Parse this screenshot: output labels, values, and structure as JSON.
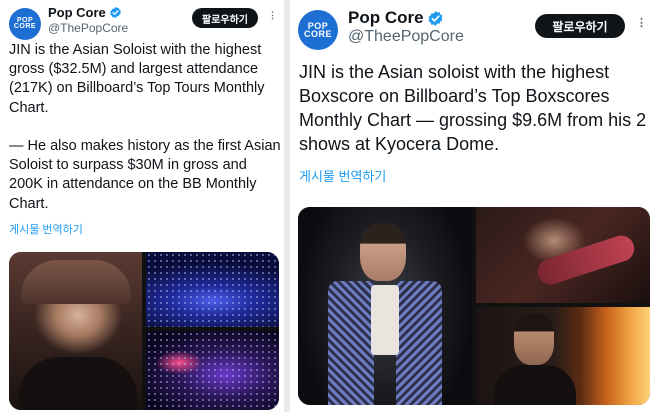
{
  "left_tweet": {
    "avatar_text_line1": "POP",
    "avatar_text_line2": "CORE",
    "display_name": "Pop Core",
    "handle": "@ThePopCore",
    "follow_label": "팔로우하기",
    "more_icon": "more-dots-icon",
    "text": "JIN is the Asian Soloist with the highest gross ($32.5M) and largest attendance (217K) on Billboard’s Top Tours Monthly Chart.\n\n— He also makes history as the first Asian Soloist to surpass $30M in gross and 200K in attendance on the BB Monthly Chart.",
    "translate_label": "게시물 번역하기"
  },
  "right_tweet": {
    "avatar_text_line1": "POP",
    "avatar_text_line2": "CORE",
    "display_name": "Pop Core",
    "handle": "@TheePopCore",
    "follow_label": "팔로우하기",
    "more_icon": "more-dots-icon",
    "text": "JIN is the Asian soloist with the highest Boxscore on Billboard’s Top Boxscores Monthly Chart — grossing $9.6M from his 2 shows at Kyocera Dome.",
    "translate_label": "게시물 번역하기"
  },
  "colors": {
    "accent_blue": "#1d9bf0",
    "verified_blue": "#1d9bf0",
    "follow_bg": "#0f1419",
    "avatar_bg": "#1d6fd4",
    "handle_gray": "#536471"
  }
}
